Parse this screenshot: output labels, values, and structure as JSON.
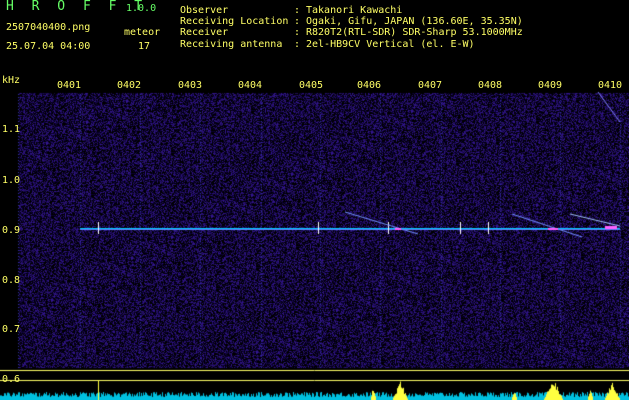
{
  "app": {
    "name": "H R O F F T",
    "version": "1.0.0"
  },
  "file": {
    "name": "2507040400.png",
    "datetime": "25.07.04 04:00"
  },
  "meteor": {
    "label": "meteor",
    "count": "17"
  },
  "info": [
    {
      "label": "Observer",
      "value": "Takanori Kawachi"
    },
    {
      "label": "Receiving Location",
      "value": "Ogaki, Gifu, JAPAN (136.60E, 35.35N)"
    },
    {
      "label": "Receiver",
      "value": "R820T2(RTL-SDR) SDR-Sharp 53.1000MHz"
    },
    {
      "label": "Receiving antenna",
      "value": "2el-HB9CV Vertical (el. E-W)"
    }
  ],
  "colors": {
    "background": "#000000",
    "accent_yellow": "#ffff66",
    "title_green": "#66ff66",
    "noise_blue": "#1a1a8c",
    "baseline_cyan": "#00c8ff"
  },
  "spectrogram": {
    "unit": "kHz",
    "time_labels": [
      "0401",
      "0402",
      "0403",
      "0404",
      "0405",
      "0406",
      "0407",
      "0408",
      "0409",
      "0410"
    ],
    "freq_labels": [
      "1.1",
      "1.0",
      "0.9",
      "0.8",
      "0.7",
      "0.6"
    ]
  }
}
